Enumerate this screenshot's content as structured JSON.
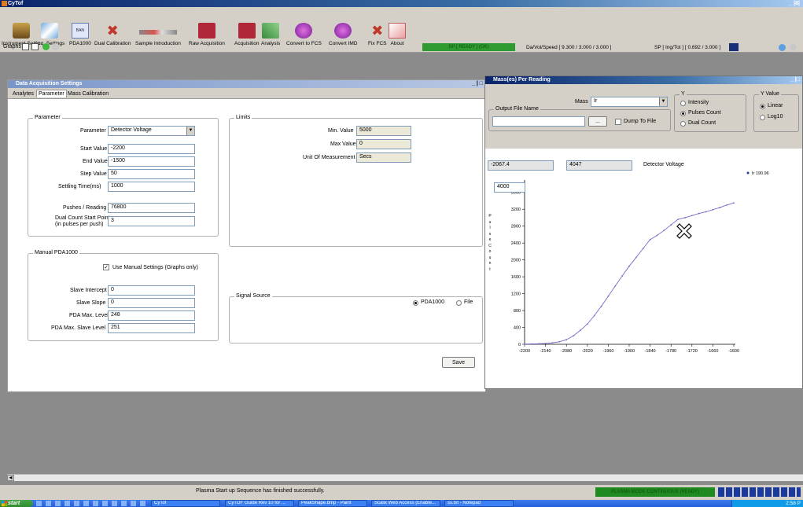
{
  "app": {
    "title": "CyTof",
    "window_controls": "_ |8|"
  },
  "toolbar": {
    "items": [
      {
        "label": "Instrument Setup",
        "icon": "instrument-icon"
      },
      {
        "label": "Acq. Settings",
        "icon": "settings-icon"
      },
      {
        "label": "PDA1000",
        "icon": "pda-icon"
      },
      {
        "label": "Dual Calibration",
        "icon": "tools-icon"
      },
      {
        "label": "Sample Introduction",
        "icon": "syringe-icon"
      },
      {
        "label": "Raw Acquisition",
        "icon": "raw-acquisition-icon"
      },
      {
        "label": "Acquisition",
        "icon": "acquisition-icon"
      },
      {
        "label": "Analysis",
        "icon": "analysis-icon"
      },
      {
        "label": "Convert to FCS",
        "icon": "convert-fcs-icon"
      },
      {
        "label": "Convert IMD",
        "icon": "convert-imd-icon"
      },
      {
        "label": "Fix FCS",
        "icon": "fix-fcs-icon"
      },
      {
        "label": "About",
        "icon": "about-icon"
      }
    ],
    "graphs_label": "Graphs",
    "status_green": "SP [ READY ] (OK)",
    "da_speed": "Da/Vol/Speed [ 9.300 / 3.000 / 3.000 ]",
    "sp_status": "SP [ Ing/Tot ] [ 0.692 / 3.000 ]"
  },
  "acq_window": {
    "title": "Data Acquisition Settings",
    "controls": "_ | □",
    "tabs": [
      "Analytes",
      "Parameter",
      "Mass Calibration"
    ],
    "active_tab": "Parameter",
    "parameter_group": {
      "title": "Parameter",
      "parameter_label": "Parameter",
      "parameter_value": "Detector Voltage",
      "start_label": "Start Value",
      "start_value": "-2200",
      "end_label": "End Value",
      "end_value": "-1500",
      "step_label": "Step Value",
      "step_value": "50",
      "settling_label": "Settling Time(ms)",
      "settling_value": "1000",
      "pushes_label": "Pushes / Reading",
      "pushes_value": "76800",
      "dual_label_1": "Dual Count Start Point",
      "dual_label_2": "(in pulses per push)",
      "dual_value": "3"
    },
    "limits_group": {
      "title": "Limits",
      "min_label": "Min. Value",
      "min_value": "5000",
      "max_label": "Max Value",
      "max_value": "0",
      "unit_label": "Unit Of Measurement",
      "unit_value": "Secs"
    },
    "manual_group": {
      "title": "Manual PDA1000",
      "use_manual_label": "Use Manual Settings (Graphs only)",
      "use_manual_checked": "✓",
      "slave_intercept_label": "Slave Intercept",
      "slave_intercept_value": "0",
      "slave_slope_label": "Slave Slope",
      "slave_slope_value": "0",
      "pda_max_label": "PDA Max. Level",
      "pda_max_value": "248",
      "pda_max_slave_label": "PDA Max. Slave Level",
      "pda_max_slave_value": "251"
    },
    "signal_group": {
      "title": "Signal Source",
      "option_pda": "PDA1000",
      "option_file": "File",
      "selected": "PDA1000"
    },
    "save_label": "Save"
  },
  "mass_window": {
    "title": "Mass(es) Per Reading",
    "controls": "_ |□",
    "mass_label": "Mass",
    "mass_value": "Ir",
    "output_group_title": "Output File Name",
    "browse_label": "...",
    "dump_label": "Dump To File",
    "y_group_title": "Y",
    "y_options": [
      "Intensity",
      "Pulses Count",
      "Dual Count"
    ],
    "y_selected": "Pulses Count",
    "yvalue_group_title": "Y Value",
    "yvalue_options": [
      "Linear",
      "Log10"
    ],
    "yvalue_selected": "Linear",
    "readout_x": "-2067.4",
    "readout_y": "4047",
    "readout_label": "Detector Voltage",
    "zoom_box_value": "4000",
    "y_axis_letters": [
      "P",
      "u",
      "l",
      "s",
      "e",
      "C",
      "o",
      "u",
      "n",
      "t"
    ]
  },
  "chart_data": {
    "type": "line",
    "xlabel": "",
    "ylabel": "PulseCount",
    "x": [
      -2200,
      -2180,
      -2160,
      -2140,
      -2120,
      -2100,
      -2080,
      -2060,
      -2040,
      -2020,
      -2000,
      -1980,
      -1960,
      -1940,
      -1920,
      -1900,
      -1880,
      -1860,
      -1840,
      -1820,
      -1800,
      -1780,
      -1760,
      -1740,
      -1720,
      -1700,
      -1680,
      -1660,
      -1640,
      -1620,
      -1600
    ],
    "series": [
      {
        "name": "Ir 190.96",
        "color": "#7b68c8",
        "values": [
          5,
          8,
          12,
          20,
          35,
          60,
          110,
          200,
          330,
          480,
          680,
          900,
          1140,
          1380,
          1620,
          1850,
          2060,
          2270,
          2480,
          2580,
          2700,
          2830,
          2960,
          3000,
          3050,
          3100,
          3140,
          3190,
          3240,
          3300,
          3350
        ]
      }
    ],
    "xticks": [
      "-2200",
      "-2140",
      "-2080",
      "-2020",
      "-1960",
      "-1900",
      "-1840",
      "-1780",
      "-1720",
      "-1660",
      "-1600"
    ],
    "yticks": [
      "0",
      "400",
      "800",
      "1200",
      "1600",
      "2000",
      "2400",
      "2800",
      "3200",
      "3600"
    ],
    "xlim": [
      -2200,
      -1600
    ],
    "ylim": [
      0,
      3800
    ],
    "legend_position": "top-right"
  },
  "status_bar": {
    "message": "Plasma Start up Sequence has finished successfully.",
    "green_text": "PLASMA MODE CONTINUOUS (READY)"
  },
  "taskbar": {
    "start": "start",
    "buttons": [
      "CyTof",
      "CyTOF Guide Rev 10 for ...",
      "PeakShape.bmp - Paint",
      "Scalix Web Access (Enable...",
      "ss.txt - Notepad"
    ],
    "clock": "2:58 P"
  }
}
